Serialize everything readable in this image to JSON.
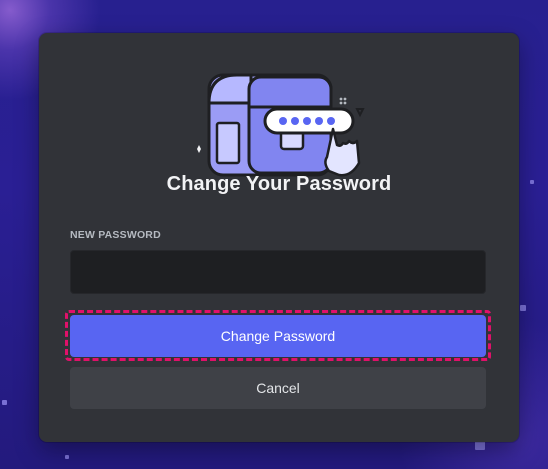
{
  "dialog": {
    "title": "Change Your Password",
    "new_password_label": "NEW PASSWORD",
    "new_password_value": "",
    "submit_label": "Change Password",
    "cancel_label": "Cancel"
  },
  "colors": {
    "primary": "#5865f2",
    "modal_bg": "#313338",
    "input_bg": "#1e1f22",
    "highlight": "#e0116a"
  },
  "icons": {
    "illustration": "treasure-chest-password-icon"
  }
}
